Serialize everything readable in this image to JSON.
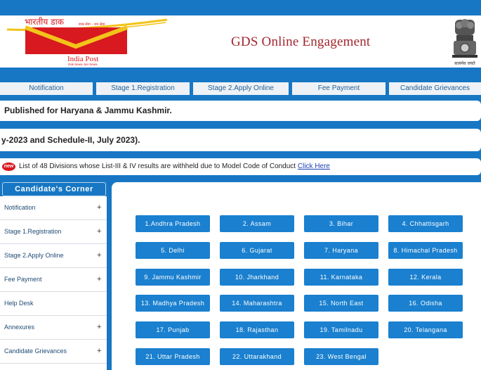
{
  "header": {
    "logo_hindi": "भारतीय डाक",
    "logo_tagline_hindi": "डाक सेवा - जन सेवा",
    "logo_text": "India Post",
    "logo_tagline": "Dak Sewa Jan Sewa",
    "site_title": "GDS Online Engagement",
    "emblem_motto": "सत्यमेव जयते"
  },
  "nav": [
    "Notification",
    "Stage 1.Registration",
    "Stage 2.Apply Online",
    "Fee Payment",
    "Candidate Grievances"
  ],
  "tickers": [
    "Published for Haryana & Jammu Kashmir.",
    "y-2023 and Schedule-II, July 2023)."
  ],
  "notice": {
    "badge": "new",
    "text": "List of 48 Divisions whose List-III & IV results are withheld due to Model Code of Conduct",
    "link": "Click Here"
  },
  "sidebar": {
    "title": "Candidate's Corner",
    "items": [
      {
        "label": "Notification",
        "marker": "+"
      },
      {
        "label": "Stage 1.Registration",
        "marker": "+"
      },
      {
        "label": "Stage 2.Apply Online",
        "marker": "+"
      },
      {
        "label": "Fee Payment",
        "marker": "+"
      },
      {
        "label": "Help Desk",
        "marker": ""
      },
      {
        "label": "Annexures",
        "marker": "+"
      },
      {
        "label": "Candidate Grievances",
        "marker": "+"
      }
    ]
  },
  "states": [
    "1.Andhra Pradesh",
    "2. Assam",
    "3. Bihar",
    "4. Chhattisgarh",
    "5. Delhi",
    "6. Gujarat",
    "7. Haryana",
    "8. Himachal Pradesh",
    "9. Jammu Kashmir",
    "10. Jharkhand",
    "11. Karnataka",
    "12. Kerala",
    "13. Madhya Pradesh",
    "14. Maharashtra",
    "15. North East",
    "16. Odisha",
    "17. Punjab",
    "18. Rajasthan",
    "19. Tamilnadu",
    "20. Telangana",
    "21. Uttar Pradesh",
    "22. Uttarakhand",
    "23. West Bengal"
  ],
  "colors": {
    "brand_blue": "#1777c4",
    "button_blue": "#1a80cf",
    "india_post_red": "#d8191f",
    "india_post_yellow": "#f2c41a",
    "title_red": "#a3262e"
  }
}
